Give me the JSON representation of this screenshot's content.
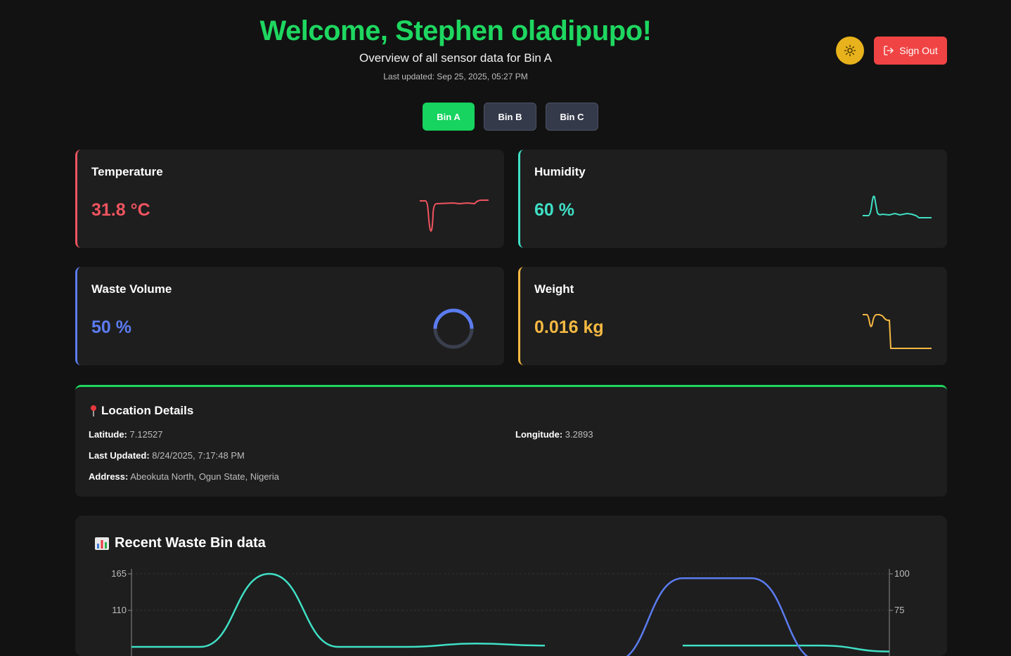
{
  "header": {
    "welcome": "Welcome, Stephen oladipupo!",
    "subtitle": "Overview of all sensor data for Bin A",
    "last_updated": "Last updated: Sep 25, 2025, 05:27 PM"
  },
  "actions": {
    "theme_icon": "sun-icon",
    "sign_out_label": "Sign Out",
    "sign_out_icon": "sign-out-icon"
  },
  "bins": {
    "active": "Bin A",
    "tabs": [
      "Bin A",
      "Bin B",
      "Bin C"
    ]
  },
  "cards": {
    "temperature": {
      "title": "Temperature",
      "value": "31.8 °C",
      "color": "#f0545f"
    },
    "humidity": {
      "title": "Humidity",
      "value": "60 %",
      "color": "#3fe0c5"
    },
    "waste_volume": {
      "title": "Waste Volume",
      "value": "50 %",
      "color": "#5b7cf0",
      "fill_fraction": 0.5
    },
    "weight": {
      "title": "Weight",
      "value": "0.016 kg",
      "color": "#f5b942"
    }
  },
  "location": {
    "title": "Location Details",
    "icon": "pin-icon",
    "latitude_label": "Latitude:",
    "latitude": "7.12527",
    "longitude_label": "Longitude:",
    "longitude": "3.2893",
    "last_updated_label": "Last Updated:",
    "last_updated": "8/24/2025, 7:17:48 PM",
    "address_label": "Address:",
    "address": "Abeokuta North, Ogun State, Nigeria",
    "accent": "#1ed760"
  },
  "recent_chart": {
    "title": "Recent Waste Bin data",
    "icon": "bar-chart-icon"
  },
  "chart_data": {
    "type": "line",
    "title": "Recent Waste Bin data",
    "y_left": {
      "ticks": [
        "165",
        "110"
      ],
      "ylim": [
        55,
        165
      ]
    },
    "y_right": {
      "ticks": [
        "100",
        "75"
      ],
      "ylim": [
        50,
        100
      ]
    },
    "grid": true,
    "series": [
      {
        "axis": "left",
        "color": "#3fe0c5",
        "values": [
          55,
          55,
          165,
          55,
          55,
          60,
          57,
          null,
          57,
          57,
          57,
          48
        ]
      },
      {
        "axis": "right",
        "color": "#5b7cf0",
        "values": [
          null,
          null,
          null,
          null,
          null,
          null,
          null,
          40,
          97,
          97,
          40,
          null
        ]
      }
    ]
  }
}
